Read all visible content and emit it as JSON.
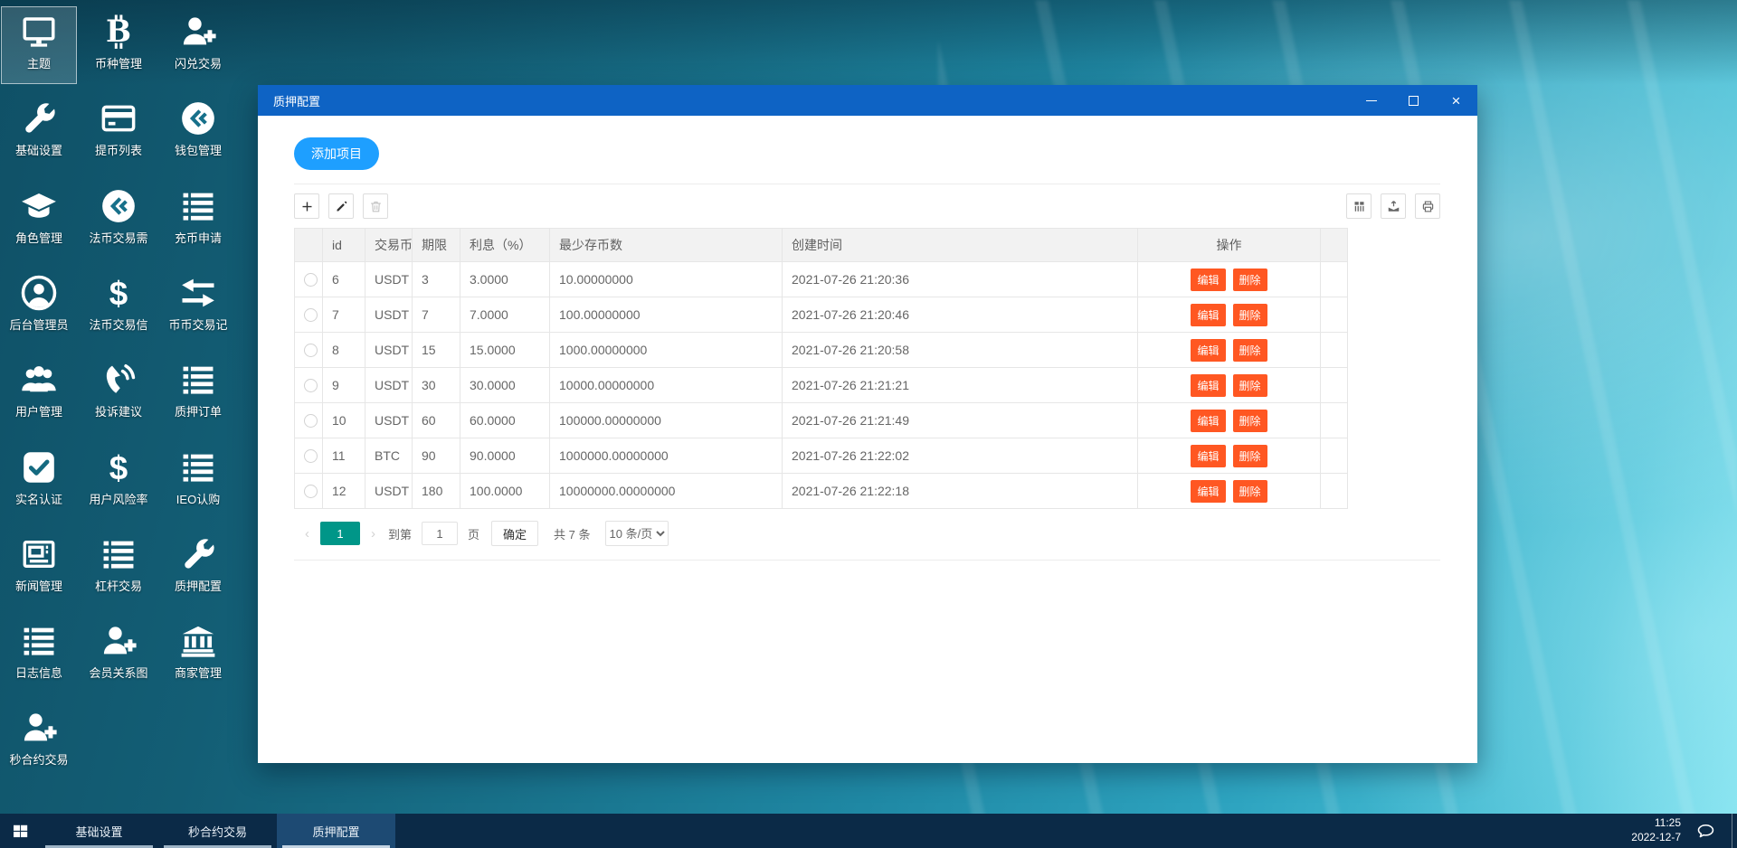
{
  "desktop": {
    "icons": [
      {
        "label": "主题",
        "icon": "monitor-icon",
        "selected": true
      },
      {
        "label": "币种管理",
        "icon": "bitcoin-icon"
      },
      {
        "label": "闪兑交易",
        "icon": "user-plus-icon"
      },
      {
        "label": "基础设置",
        "icon": "wrench-icon"
      },
      {
        "label": "提币列表",
        "icon": "credit-card-icon"
      },
      {
        "label": "钱包管理",
        "icon": "coin-circle-icon"
      },
      {
        "label": "角色管理",
        "icon": "graduation-cap-icon"
      },
      {
        "label": "法币交易需",
        "icon": "coin-circle-icon"
      },
      {
        "label": "充币申请",
        "icon": "list-icon"
      },
      {
        "label": "后台管理员",
        "icon": "user-circle-icon"
      },
      {
        "label": "法币交易信",
        "icon": "dollar-icon"
      },
      {
        "label": "币币交易记",
        "icon": "swap-arrows-icon"
      },
      {
        "label": "用户管理",
        "icon": "users-icon"
      },
      {
        "label": "投诉建议",
        "icon": "phone-icon"
      },
      {
        "label": "质押订单",
        "icon": "list-icon"
      },
      {
        "label": "实名认证",
        "icon": "check-square-icon"
      },
      {
        "label": "用户风险率",
        "icon": "dollar-icon"
      },
      {
        "label": "IEO认购",
        "icon": "list-icon"
      },
      {
        "label": "新闻管理",
        "icon": "newspaper-icon"
      },
      {
        "label": "杠杆交易",
        "icon": "list-icon"
      },
      {
        "label": "质押配置",
        "icon": "wrench-icon"
      },
      {
        "label": "日志信息",
        "icon": "list-icon"
      },
      {
        "label": "会员关系图",
        "icon": "user-plus-icon"
      },
      {
        "label": "商家管理",
        "icon": "bank-icon"
      },
      {
        "label": "秒合约交易",
        "icon": "user-plus-icon"
      }
    ]
  },
  "window": {
    "title": "质押配置",
    "add_button": "添加项目",
    "toolbar": {
      "left_icons": [
        "add-icon",
        "pencil-icon",
        "trash-icon"
      ],
      "right_icons": [
        "columns-icon",
        "export-icon",
        "print-icon"
      ]
    },
    "table": {
      "headers": [
        "id",
        "交易币",
        "期限",
        "利息（%）",
        "最少存币数",
        "创建时间",
        "操作"
      ],
      "rows": [
        {
          "id": "6",
          "coin": "USDT",
          "term": "3",
          "interest": "3.0000",
          "min_deposit": "10.00000000",
          "created": "2021-07-26 21:20:36"
        },
        {
          "id": "7",
          "coin": "USDT",
          "term": "7",
          "interest": "7.0000",
          "min_deposit": "100.00000000",
          "created": "2021-07-26 21:20:46"
        },
        {
          "id": "8",
          "coin": "USDT",
          "term": "15",
          "interest": "15.0000",
          "min_deposit": "1000.00000000",
          "created": "2021-07-26 21:20:58"
        },
        {
          "id": "9",
          "coin": "USDT",
          "term": "30",
          "interest": "30.0000",
          "min_deposit": "10000.00000000",
          "created": "2021-07-26 21:21:21"
        },
        {
          "id": "10",
          "coin": "USDT",
          "term": "60",
          "interest": "60.0000",
          "min_deposit": "100000.00000000",
          "created": "2021-07-26 21:21:49"
        },
        {
          "id": "11",
          "coin": "BTC",
          "term": "90",
          "interest": "90.0000",
          "min_deposit": "1000000.00000000",
          "created": "2021-07-26 21:22:02"
        },
        {
          "id": "12",
          "coin": "USDT",
          "term": "180",
          "interest": "100.0000",
          "min_deposit": "10000000.00000000",
          "created": "2021-07-26 21:22:18"
        }
      ],
      "actions": {
        "edit": "编辑",
        "delete": "删除"
      }
    },
    "pagination": {
      "prev": "‹",
      "current_page": "1",
      "next": "›",
      "goto_label": "到第",
      "page_input": "1",
      "page_label": "页",
      "confirm": "确定",
      "total": "共 7 条",
      "page_size": "10 条/页"
    }
  },
  "taskbar": {
    "items": [
      {
        "label": "基础设置",
        "active": false
      },
      {
        "label": "秒合约交易",
        "active": false
      },
      {
        "label": "质押配置",
        "active": true
      }
    ],
    "clock": {
      "time": "11:25",
      "date": "2022-12-7"
    }
  },
  "colors": {
    "titlebar": "#0e63c4",
    "accent_blue": "#1E9FFF",
    "teal": "#009688",
    "danger": "#FF5722",
    "taskbar": "#0b2a47"
  }
}
